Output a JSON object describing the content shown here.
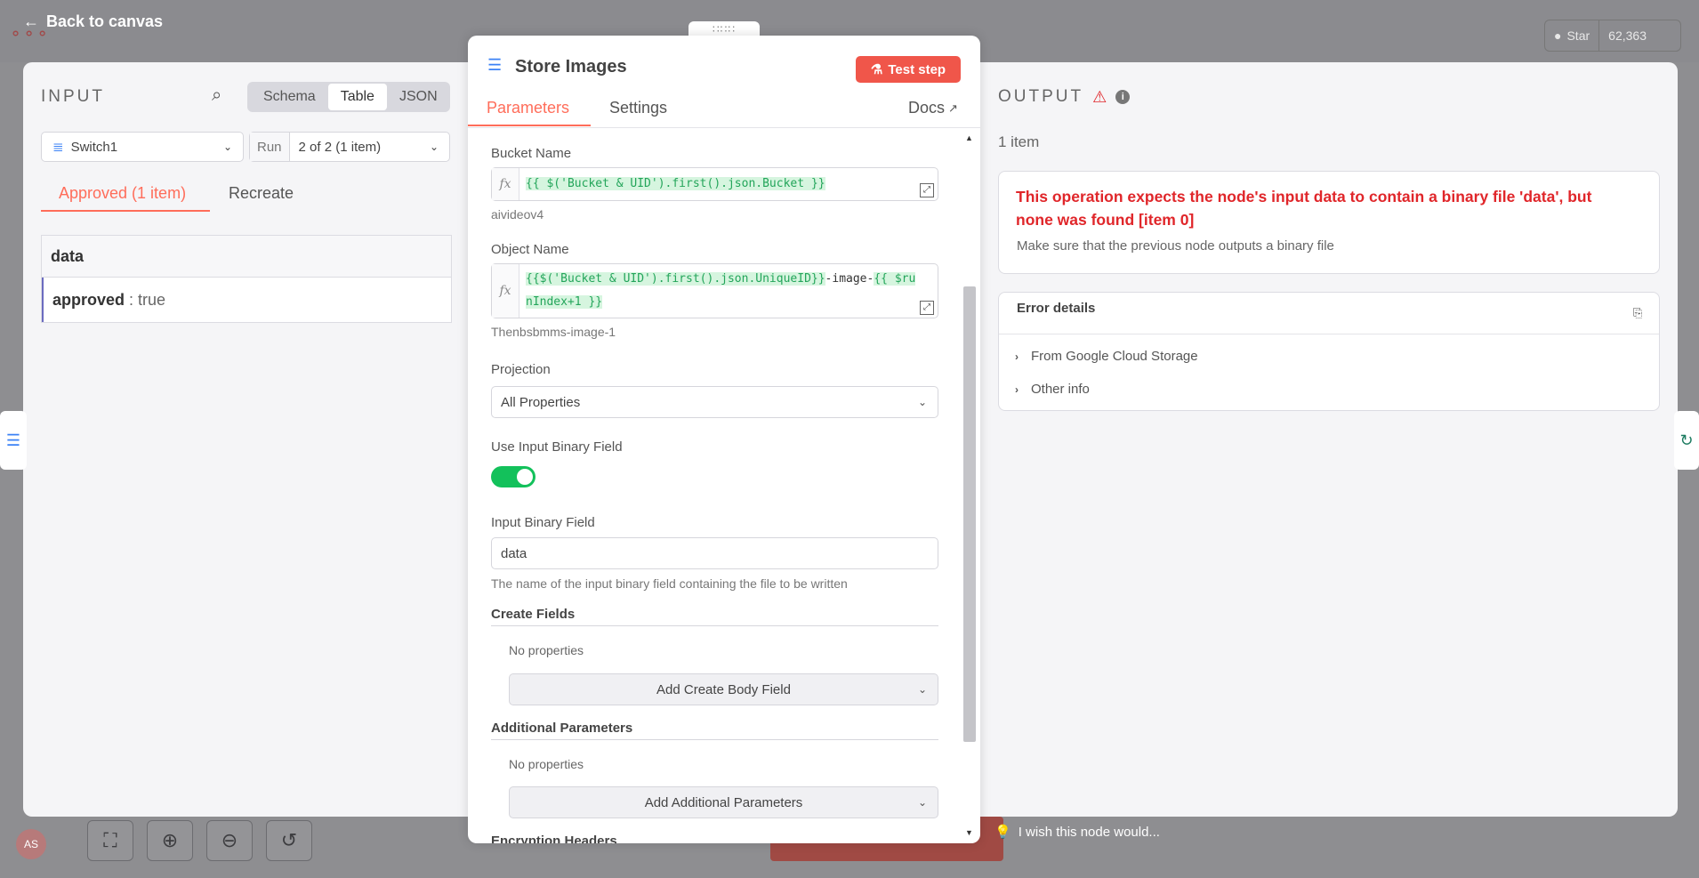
{
  "topbar": {
    "back_label": "Back to canvas",
    "github_star_label": "Star",
    "github_star_count": "62,363"
  },
  "input_panel": {
    "title": "INPUT",
    "view_modes": [
      "Schema",
      "Table",
      "JSON"
    ],
    "active_view": "Table",
    "node_select_value": "Switch1",
    "run_label": "Run",
    "run_select_value": "2 of 2 (1 item)",
    "output_tabs": [
      "Approved (1 item)",
      "Recreate"
    ],
    "active_output_tab": "Approved (1 item)",
    "table": {
      "header": "data",
      "row_key": "approved",
      "row_separator": " : ",
      "row_value": "true"
    }
  },
  "node": {
    "title": "Store Images",
    "test_button_label": "Test step",
    "tabs": [
      "Parameters",
      "Settings"
    ],
    "active_tab": "Parameters",
    "docs_label": "Docs",
    "fields": {
      "bucket_name": {
        "label": "Bucket Name",
        "expression": "{{ $('Bucket & UID').first().json.Bucket }}",
        "resolved": "aivideov4"
      },
      "object_name": {
        "label": "Object Name",
        "expr_part1": "{{$('Bucket & UID').first().json.UniqueID}}",
        "literal": "-image-",
        "expr_part2_line1": "{{ $ru",
        "expr_part2_line2": "nIndex+1 }}",
        "resolved": "Thenbsbmms-image-1"
      },
      "projection": {
        "label": "Projection",
        "value": "All Properties"
      },
      "use_input_binary_field": {
        "label": "Use Input Binary Field",
        "enabled": true
      },
      "input_binary_field": {
        "label": "Input Binary Field",
        "value": "data",
        "hint": "The name of the input binary field containing the file to be written"
      },
      "create_fields": {
        "title": "Create Fields",
        "empty_text": "No properties",
        "add_button": "Add Create Body Field"
      },
      "additional_parameters": {
        "title": "Additional Parameters",
        "empty_text": "No properties",
        "add_button": "Add Additional Parameters"
      },
      "encryption_headers": {
        "title": "Encryption Headers"
      }
    },
    "fx_label": "fx"
  },
  "output_panel": {
    "title": "OUTPUT",
    "item_count": "1 item",
    "error_title": "This operation expects the node's input data to contain a binary file 'data', but none was found [item 0]",
    "error_hint": "Make sure that the previous node outputs a binary file",
    "error_details_title": "Error details",
    "detail_items": [
      "From Google Cloud Storage",
      "Other info"
    ]
  },
  "feedback_label": "I wish this node would...",
  "avatar_initials": "AS",
  "colors": {
    "accent": "#ff6d5a",
    "error": "#e0262a",
    "toggle": "#13c15b",
    "expression_bg": "#d6f5df",
    "expression_text": "#23a55a"
  },
  "icons": [
    "arrow-left-icon",
    "search-icon",
    "switch-node-icon",
    "chevron-down-icon",
    "database-icon",
    "flask-icon",
    "external-link-icon",
    "warning-icon",
    "info-icon",
    "copy-icon",
    "chevron-right-icon",
    "expand-icon",
    "lightbulb-icon",
    "github-icon",
    "fit-view-icon",
    "zoom-in-icon",
    "zoom-out-icon",
    "undo-icon"
  ]
}
